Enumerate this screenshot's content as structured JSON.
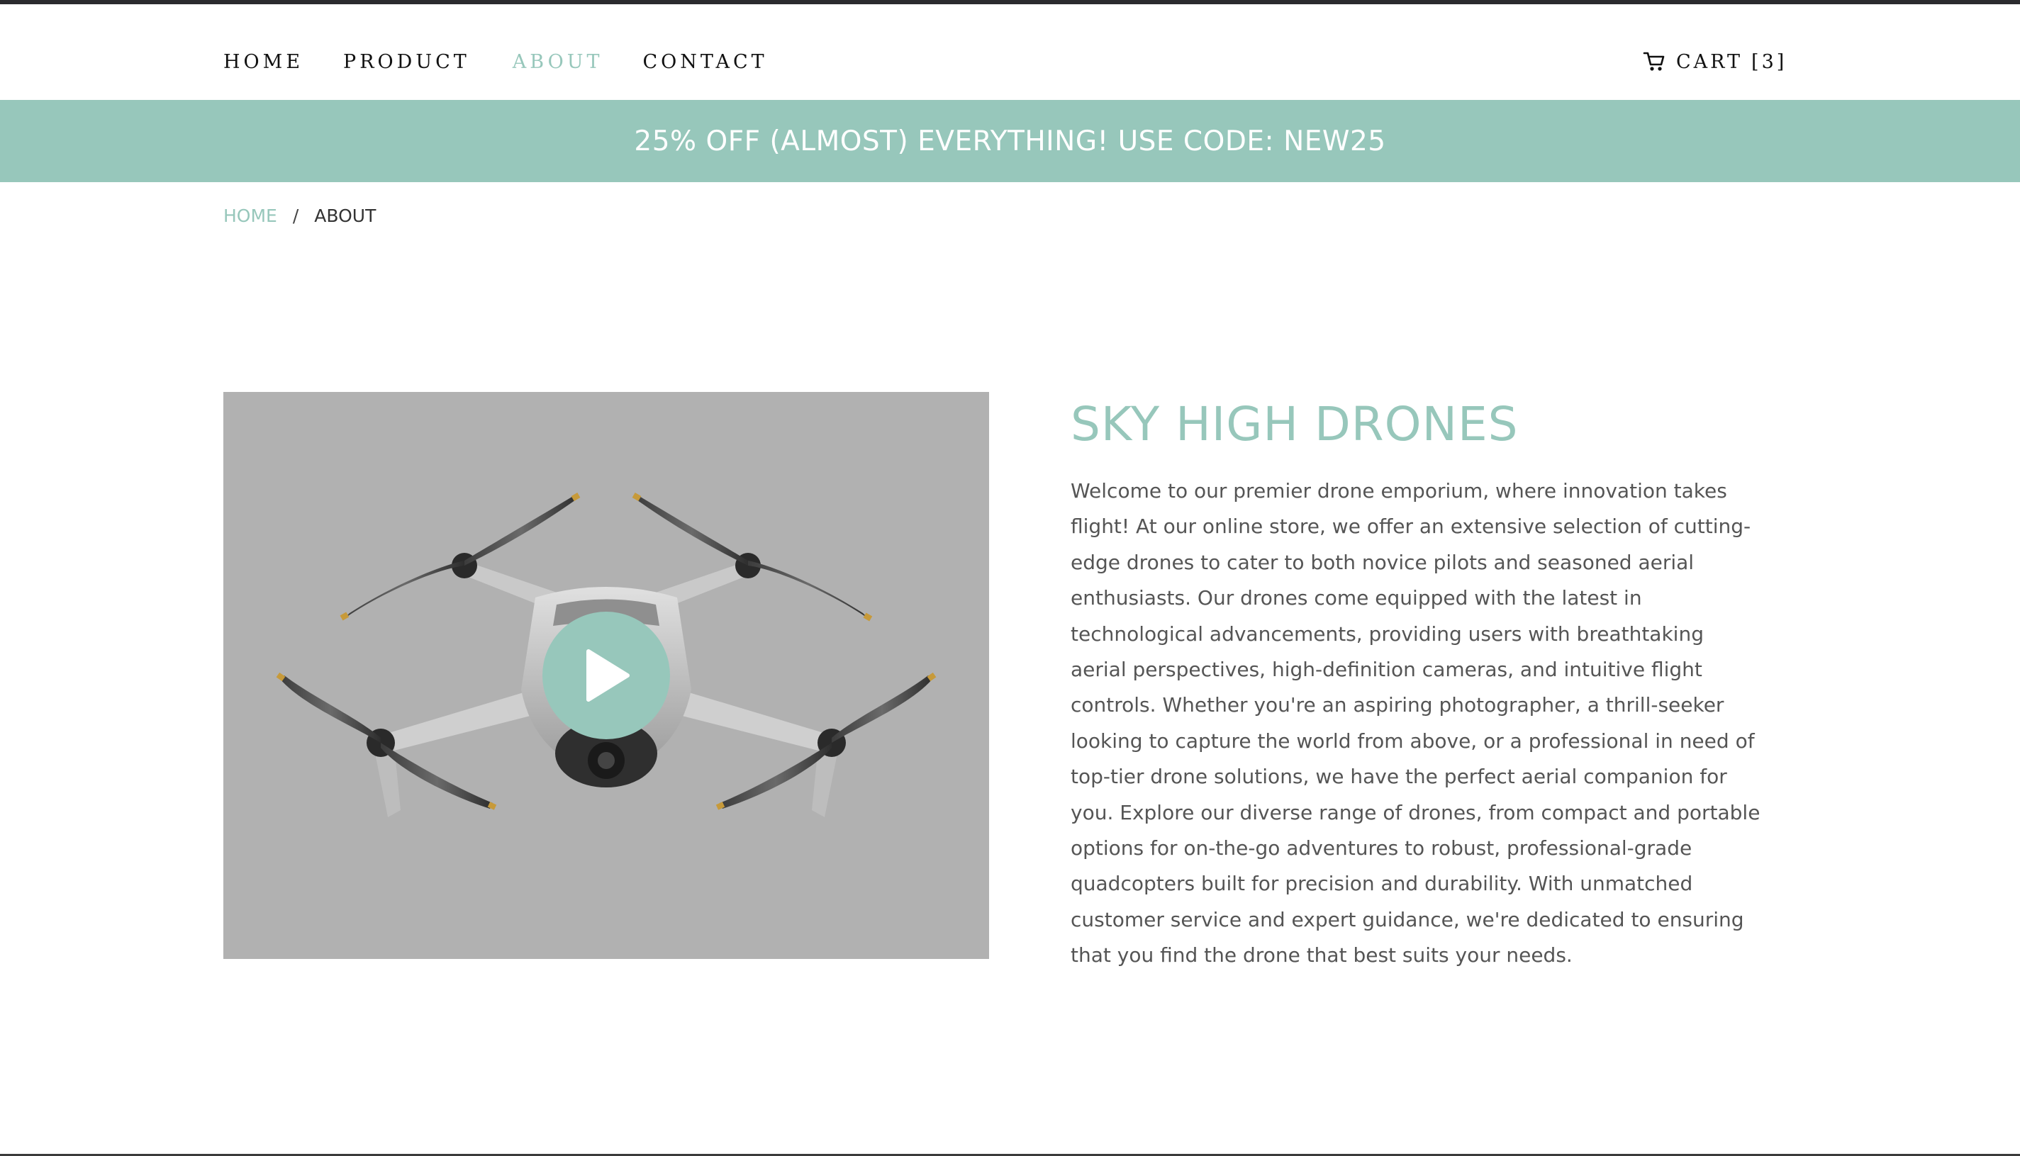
{
  "nav": {
    "items": [
      {
        "label": "HOME"
      },
      {
        "label": "PRODUCT"
      },
      {
        "label": "ABOUT"
      },
      {
        "label": "CONTACT"
      }
    ],
    "active": "ABOUT"
  },
  "cart": {
    "label": "CART",
    "count": "[3]",
    "icon": "cart-icon"
  },
  "promo": {
    "text": "25% OFF (ALMOST) EVERYTHING! USE CODE: NEW25"
  },
  "breadcrumb": {
    "home": "HOME",
    "separator": "/",
    "current": "ABOUT"
  },
  "about": {
    "title": "SKY HIGH DRONES",
    "body": "Welcome to our premier drone emporium, where innovation takes flight! At our online store, we offer an extensive selection of cutting-edge drones to cater to both novice pilots and seasoned aerial enthusiasts. Our drones come equipped with the latest in technological advancements, providing users with breathtaking aerial perspectives, high-definition cameras, and intuitive flight controls. Whether you're an aspiring photographer, a thrill-seeker looking to capture the world from above, or a professional in need of top-tier drone solutions, we have the perfect aerial companion for you. Explore our diverse range of drones, from compact and portable options for on-the-go adventures to robust, professional-grade quadcopters built for precision and durability. With unmatched customer service and expert guidance, we're dedicated to ensuring that you find the drone that best suits your needs."
  },
  "video": {
    "icon": "play-icon"
  },
  "colors": {
    "accent": "#97c7bb",
    "topbar": "#2b2b2e",
    "video_bg": "#b1b1b1",
    "text": "#555555"
  }
}
